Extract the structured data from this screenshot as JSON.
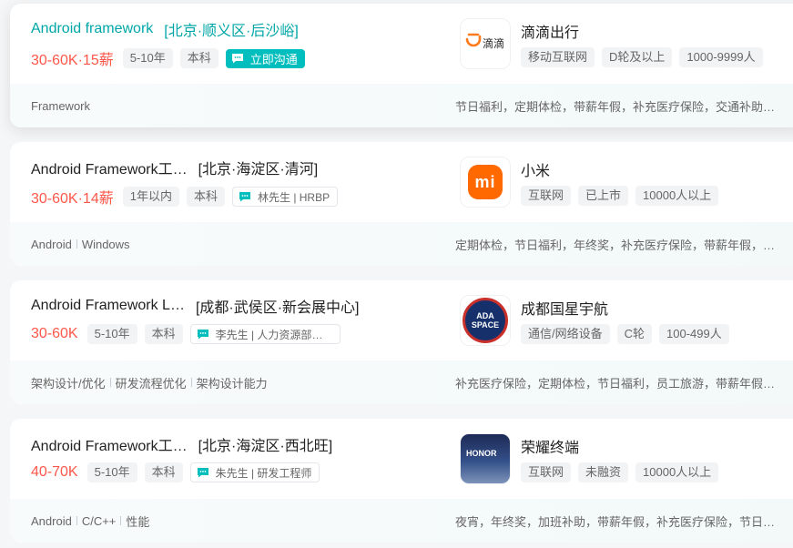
{
  "jobs": [
    {
      "title": "Android framework",
      "area": "[北京·顺义区·后沙峪]",
      "salary": "30-60K·15薪",
      "tags": [
        "5-10年",
        "本科"
      ],
      "chat_label": "立即沟通",
      "skills": [
        "Framework"
      ],
      "welfare": "节日福利，定期体检，带薪年假，补充医疗保险，交通补助…",
      "company": {
        "name": "滴滴出行",
        "logo_text": "滴滴",
        "tags": [
          "移动互联网",
          "D轮及以上",
          "1000-9999人"
        ]
      }
    },
    {
      "title": "Android Framework工…",
      "area": "[北京·海淀区·清河]",
      "salary": "30-60K·14薪",
      "tags": [
        "1年以内",
        "本科"
      ],
      "contact": "林先生 | HRBP",
      "skills": [
        "Android",
        "Windows"
      ],
      "welfare": "定期体检，节日福利，年终奖，补充医疗保险，带薪年假，…",
      "company": {
        "name": "小米",
        "logo_text": "mi",
        "tags": [
          "互联网",
          "已上市",
          "10000人以上"
        ]
      }
    },
    {
      "title": "Android Framework L…",
      "area": "[成都·武侯区·新会展中心]",
      "salary": "30-60K",
      "tags": [
        "5-10年",
        "本科"
      ],
      "contact": "李先生 | 人力资源部副…",
      "skills": [
        "架构设计/优化",
        "研发流程优化",
        "架构设计能力"
      ],
      "welfare": "补充医疗保险，定期体检，节日福利，员工旅游，带薪年假…",
      "company": {
        "name": "成都国星宇航",
        "logo_text": "ADA SPACE",
        "tags": [
          "通信/网络设备",
          "C轮",
          "100-499人"
        ]
      }
    },
    {
      "title": "Android Framework工…",
      "area": "[北京·海淀区·西北旺]",
      "salary": "40-70K",
      "tags": [
        "5-10年",
        "本科"
      ],
      "contact": "朱先生 | 研发工程师",
      "skills": [
        "Android",
        "C/C++",
        "性能"
      ],
      "welfare": "夜宵，年终奖，加班补助，带薪年假，补充医疗保险，节日…",
      "company": {
        "name": "荣耀终端",
        "logo_text": "HONOR",
        "tags": [
          "互联网",
          "未融资",
          "10000人以上"
        ]
      }
    }
  ],
  "colors": {
    "accent": "#00bebd",
    "salary": "#fe574a",
    "didi": "#ff7a1a",
    "xiaomi": "#ff6900"
  }
}
